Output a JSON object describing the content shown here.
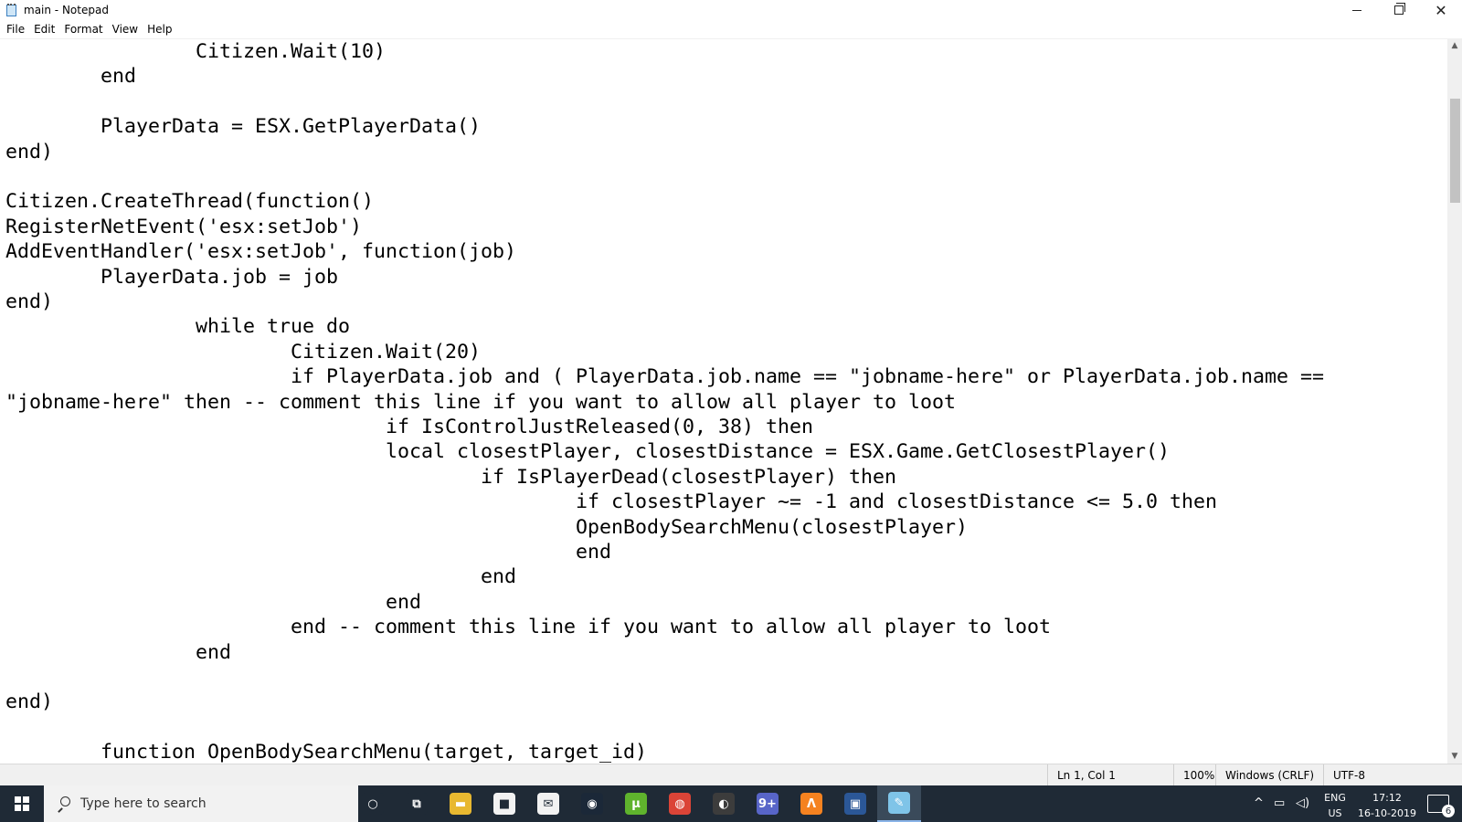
{
  "window": {
    "title": "main - Notepad"
  },
  "menu": [
    "File",
    "Edit",
    "Format",
    "View",
    "Help"
  ],
  "editor": {
    "lines": [
      "                Citizen.Wait(10)",
      "        end",
      "",
      "        PlayerData = ESX.GetPlayerData()",
      "end)",
      "",
      "Citizen.CreateThread(function()",
      "RegisterNetEvent('esx:setJob')",
      "AddEventHandler('esx:setJob', function(job)",
      "        PlayerData.job = job",
      "end)",
      "                while true do",
      "                        Citizen.Wait(20)",
      "                        if PlayerData.job and ( PlayerData.job.name == \"jobname-here\" or PlayerData.job.name ==",
      "\"jobname-here\" then -- comment this line if you want to allow all player to loot",
      "                                if IsControlJustReleased(0, 38) then",
      "                                local closestPlayer, closestDistance = ESX.Game.GetClosestPlayer()",
      "                                        if IsPlayerDead(closestPlayer) then",
      "                                                if closestPlayer ~= -1 and closestDistance <= 5.0 then",
      "                                                OpenBodySearchMenu(closestPlayer)",
      "                                                end",
      "                                        end",
      "                                end",
      "                        end -- comment this line if you want to allow all player to loot",
      "                end",
      "",
      "end)",
      "",
      "        function OpenBodySearchMenu(target, target_id)"
    ]
  },
  "status": {
    "position": "Ln 1, Col 1",
    "zoom": "100%",
    "line_ending": "Windows (CRLF)",
    "encoding": "UTF-8"
  },
  "taskbar": {
    "search_placeholder": "Type here to search",
    "apps": [
      {
        "name": "cortana",
        "color": "#1f2a36",
        "glyph": "○"
      },
      {
        "name": "task-view",
        "color": "#1f2a36",
        "glyph": "⧉"
      },
      {
        "name": "file-explorer",
        "color": "#e8b830",
        "glyph": "▬"
      },
      {
        "name": "store",
        "color": "#f2f2f2",
        "glyph": "■"
      },
      {
        "name": "mail",
        "color": "#f2f2f2",
        "glyph": "✉"
      },
      {
        "name": "steam",
        "color": "#1b2838",
        "glyph": "◉"
      },
      {
        "name": "utorrent",
        "color": "#5fb32d",
        "glyph": "µ"
      },
      {
        "name": "chrome",
        "color": "#db4437",
        "glyph": "◍"
      },
      {
        "name": "obs",
        "color": "#3c3c3c",
        "glyph": "◐"
      },
      {
        "name": "app-badge",
        "color": "#5865c8",
        "glyph": "9+"
      },
      {
        "name": "app-orange",
        "color": "#f58220",
        "glyph": "Λ"
      },
      {
        "name": "app-blue",
        "color": "#2b5797",
        "glyph": "▣"
      },
      {
        "name": "notepad",
        "color": "#7fc4e8",
        "glyph": "✎"
      }
    ],
    "tray": {
      "lang_top": "ENG",
      "lang_bottom": "US",
      "time": "17:12",
      "date": "16-10-2019",
      "notifications": "6"
    }
  }
}
